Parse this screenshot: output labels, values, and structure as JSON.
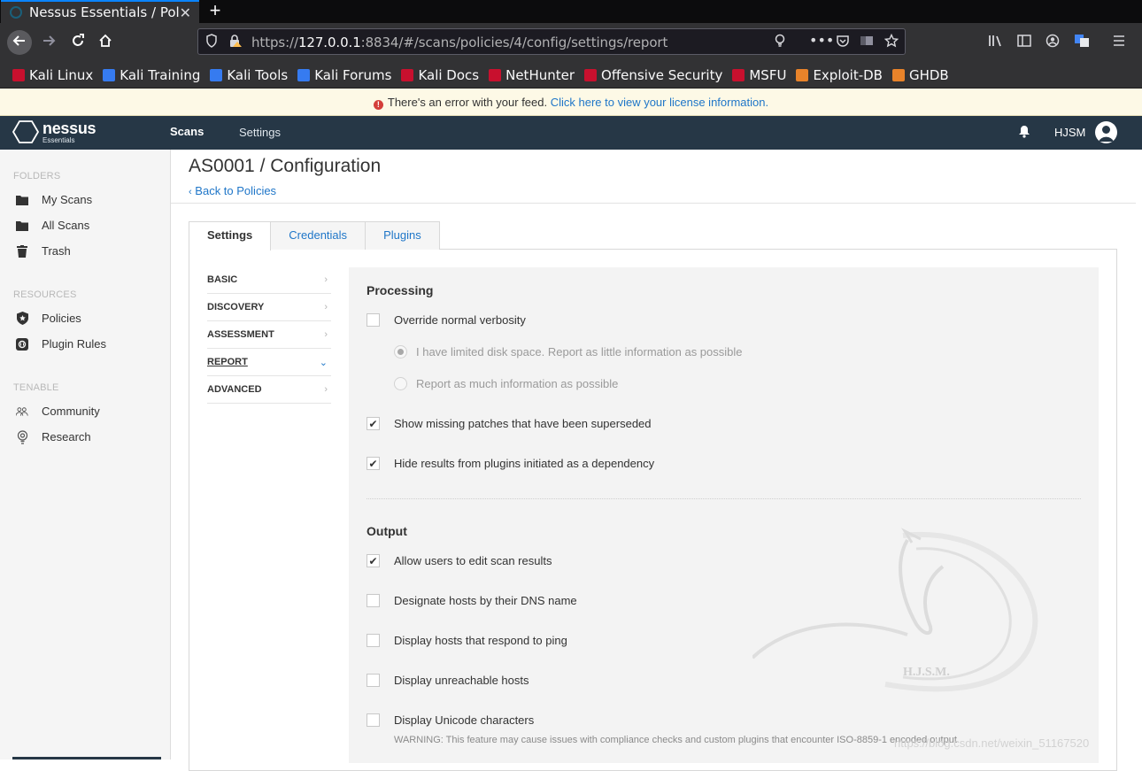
{
  "browser": {
    "tab_title": "Nessus Essentials / Policie",
    "tab_close": "✕",
    "new_tab": "+",
    "url_prefix": "https://",
    "url_host": "127.0.0.1",
    "url_rest": ":8834/#/scans/policies/4/config/settings/report",
    "bookmarks": [
      {
        "label": "Kali Linux",
        "color": "#c8102e"
      },
      {
        "label": "Kali Training",
        "color": "#367bf0"
      },
      {
        "label": "Kali Tools",
        "color": "#367bf0"
      },
      {
        "label": "Kali Forums",
        "color": "#367bf0"
      },
      {
        "label": "Kali Docs",
        "color": "#c8102e"
      },
      {
        "label": "NetHunter",
        "color": "#c8102e"
      },
      {
        "label": "Offensive Security",
        "color": "#c8102e"
      },
      {
        "label": "MSFU",
        "color": "#c8102e"
      },
      {
        "label": "Exploit-DB",
        "color": "#e8832a"
      },
      {
        "label": "GHDB",
        "color": "#e8832a"
      }
    ]
  },
  "notice": {
    "icon": "!",
    "text": "There's an error with your feed. ",
    "link": "Click here to view your license information."
  },
  "header": {
    "logo_word": "nessus",
    "logo_sub": "Essentials",
    "nav_scans": "Scans",
    "nav_settings": "Settings",
    "username": "HJSM"
  },
  "sidebar": {
    "folders_title": "FOLDERS",
    "folders": [
      "My Scans",
      "All Scans",
      "Trash"
    ],
    "resources_title": "RESOURCES",
    "resources": [
      "Policies",
      "Plugin Rules"
    ],
    "tenable_title": "TENABLE",
    "tenable": [
      "Community",
      "Research"
    ]
  },
  "main": {
    "title": "AS0001 / Configuration",
    "back_link": "Back to Policies",
    "tabs": [
      "Settings",
      "Credentials",
      "Plugins"
    ],
    "subnav": [
      "BASIC",
      "DISCOVERY",
      "ASSESSMENT",
      "REPORT",
      "ADVANCED"
    ],
    "processing_title": "Processing",
    "override_verbosity": "Override normal verbosity",
    "radio_limited": "I have limited disk space. Report as little information as possible",
    "radio_much": "Report as much information as possible",
    "show_missing": "Show missing patches that have been superseded",
    "hide_results": "Hide results from plugins initiated as a dependency",
    "output_title": "Output",
    "allow_edit": "Allow users to edit scan results",
    "dns_name": "Designate hosts by their DNS name",
    "respond_ping": "Display hosts that respond to ping",
    "unreachable": "Display unreachable hosts",
    "unicode": "Display Unicode characters",
    "warning": "WARNING: This feature may cause issues with compliance checks and custom plugins that encounter ISO-8859-1 encoded output.",
    "checkmark": "✔"
  },
  "watermark": {
    "logo_text": "H.J.S.M.",
    "url": "https://blog.csdn.net/weixin_51167520"
  }
}
